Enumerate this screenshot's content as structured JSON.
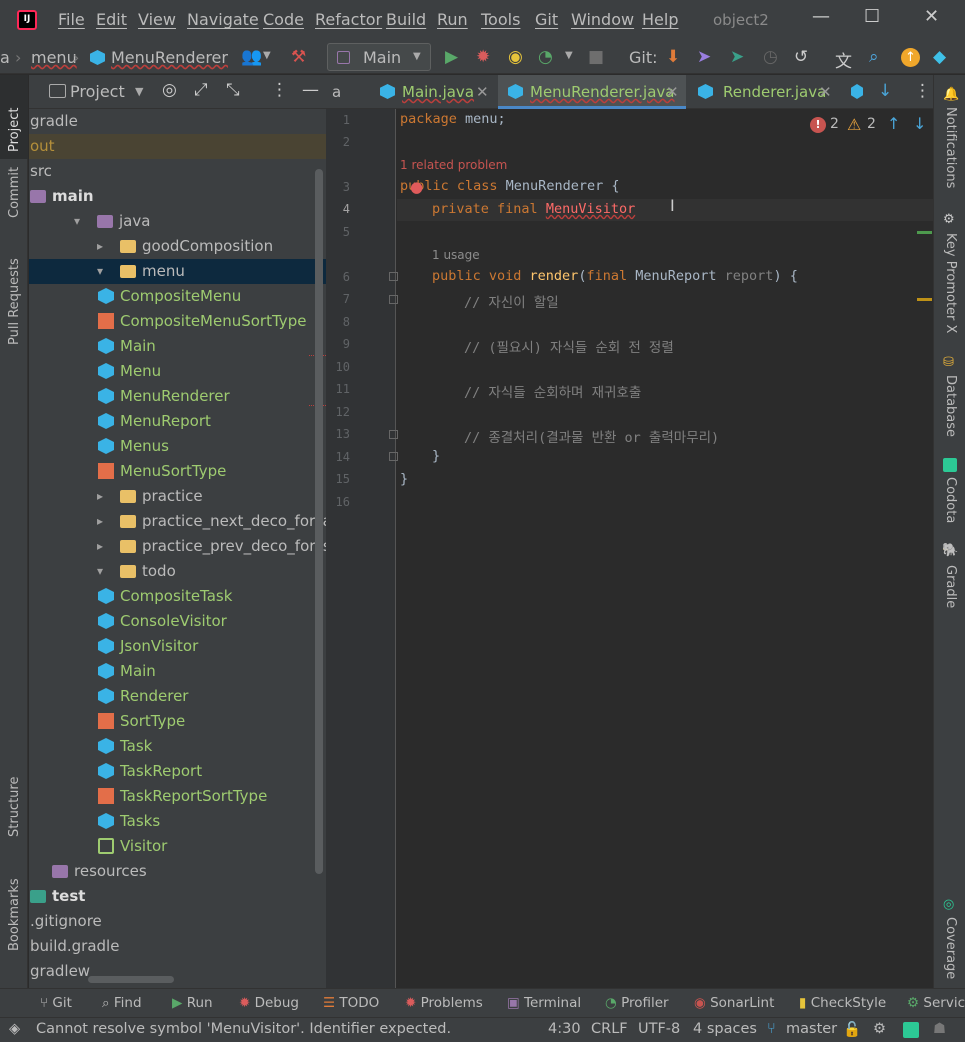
{
  "menubar": {
    "items": [
      "File",
      "Edit",
      "View",
      "Navigate",
      "Code",
      "Refactor",
      "Build",
      "Run",
      "Tools",
      "Git",
      "Window",
      "Help"
    ],
    "project_name": "object2",
    "min_glyph": "—",
    "max_glyph": "☐",
    "close_glyph": "✕"
  },
  "navbar": {
    "crumb_prev": "a",
    "crumb_menu": "menu",
    "crumb_file": "MenuRenderer",
    "run_config": "Main",
    "git_label": "Git:"
  },
  "sidebar_left": {
    "project": "Project",
    "commit": "Commit",
    "pull_requests": "Pull Requests",
    "structure": "Structure",
    "bookmarks": "Bookmarks"
  },
  "sidebar_right": {
    "notifications": "Notifications",
    "key_promoter": "Key Promoter X",
    "database": "Database",
    "codota": "Codota",
    "gradle": "Gradle",
    "coverage": "Coverage"
  },
  "project_panel": {
    "title": "Project"
  },
  "tree": [
    {
      "label": "gradle",
      "indent": 0,
      "arrow": "",
      "icon": "none",
      "style": "plain"
    },
    {
      "label": "out",
      "indent": 0,
      "arrow": "",
      "icon": "none",
      "style": "out"
    },
    {
      "label": "src",
      "indent": 0,
      "arrow": "",
      "icon": "none",
      "style": "plain"
    },
    {
      "label": "main",
      "indent": 0,
      "arrow": "",
      "icon": "folder-purple",
      "style": "bold"
    },
    {
      "label": "java",
      "indent": 1,
      "arrow": "▾",
      "icon": "folder-source",
      "style": "plain"
    },
    {
      "label": "goodComposition",
      "indent": 2,
      "arrow": "▸",
      "icon": "folder",
      "style": "plain"
    },
    {
      "label": "menu",
      "indent": 2,
      "arrow": "▾",
      "icon": "folder",
      "style": "plain",
      "selected": true
    },
    {
      "label": "CompositeMenu",
      "indent": 3,
      "arrow": "",
      "icon": "class",
      "style": "green"
    },
    {
      "label": "CompositeMenuSortType",
      "indent": 3,
      "arrow": "",
      "icon": "enum",
      "style": "green"
    },
    {
      "label": "Main",
      "indent": 3,
      "arrow": "",
      "icon": "class-main",
      "style": "green",
      "wavy": true
    },
    {
      "label": "Menu",
      "indent": 3,
      "arrow": "",
      "icon": "class",
      "style": "green"
    },
    {
      "label": "MenuRenderer",
      "indent": 3,
      "arrow": "",
      "icon": "class",
      "style": "green",
      "wavy": true
    },
    {
      "label": "MenuReport",
      "indent": 3,
      "arrow": "",
      "icon": "class",
      "style": "green"
    },
    {
      "label": "Menus",
      "indent": 3,
      "arrow": "",
      "icon": "class",
      "style": "green"
    },
    {
      "label": "MenuSortType",
      "indent": 3,
      "arrow": "",
      "icon": "enum",
      "style": "green"
    },
    {
      "label": "practice",
      "indent": 2,
      "arrow": "▸",
      "icon": "folder",
      "style": "plain"
    },
    {
      "label": "practice_next_deco_for_adding_cu",
      "indent": 2,
      "arrow": "▸",
      "icon": "folder",
      "style": "plain"
    },
    {
      "label": "practice_prev_deco_for_section",
      "indent": 2,
      "arrow": "▸",
      "icon": "folder",
      "style": "plain"
    },
    {
      "label": "todo",
      "indent": 2,
      "arrow": "▾",
      "icon": "folder",
      "style": "plain"
    },
    {
      "label": "CompositeTask",
      "indent": 3,
      "arrow": "",
      "icon": "class",
      "style": "green"
    },
    {
      "label": "ConsoleVisitor",
      "indent": 3,
      "arrow": "",
      "icon": "class",
      "style": "green"
    },
    {
      "label": "JsonVisitor",
      "indent": 3,
      "arrow": "",
      "icon": "class",
      "style": "green"
    },
    {
      "label": "Main",
      "indent": 3,
      "arrow": "",
      "icon": "class-main",
      "style": "green"
    },
    {
      "label": "Renderer",
      "indent": 3,
      "arrow": "",
      "icon": "class",
      "style": "green"
    },
    {
      "label": "SortType",
      "indent": 3,
      "arrow": "",
      "icon": "enum",
      "style": "green"
    },
    {
      "label": "Task",
      "indent": 3,
      "arrow": "",
      "icon": "class",
      "style": "green"
    },
    {
      "label": "TaskReport",
      "indent": 3,
      "arrow": "",
      "icon": "class",
      "style": "green"
    },
    {
      "label": "TaskReportSortType",
      "indent": 3,
      "arrow": "",
      "icon": "enum",
      "style": "green"
    },
    {
      "label": "Tasks",
      "indent": 3,
      "arrow": "",
      "icon": "class",
      "style": "green"
    },
    {
      "label": "Visitor",
      "indent": 3,
      "arrow": "",
      "icon": "interface",
      "style": "green"
    },
    {
      "label": "resources",
      "indent": 1,
      "arrow": "",
      "icon": "folder-res",
      "style": "plain"
    },
    {
      "label": "test",
      "indent": 0,
      "arrow": "",
      "icon": "folder-test",
      "style": "bold"
    },
    {
      "label": ".gitignore",
      "indent": 0,
      "arrow": "",
      "icon": "none",
      "style": "plain"
    },
    {
      "label": "build.gradle",
      "indent": 0,
      "arrow": "",
      "icon": "none",
      "style": "plain"
    },
    {
      "label": "gradlew",
      "indent": 0,
      "arrow": "",
      "icon": "none",
      "style": "plain"
    }
  ],
  "tabs": [
    {
      "label": "a",
      "active": false,
      "close": false
    },
    {
      "label": "Main.java",
      "active": false,
      "close": true
    },
    {
      "label": "MenuRenderer.java",
      "active": true,
      "close": true
    },
    {
      "label": "Renderer.java",
      "active": false,
      "close": true
    }
  ],
  "inspections": {
    "errors": "2",
    "warnings": "2"
  },
  "editor": {
    "line_numbers": [
      "1",
      "2",
      "3",
      "4",
      "5",
      "6",
      "7",
      "8",
      "9",
      "10",
      "11",
      "12",
      "13",
      "14",
      "15",
      "16"
    ],
    "hint_problem": "1 related problem",
    "hint_usage": "1 usage",
    "l1_kw": "package",
    "l1_rest": " menu;",
    "l3_kw": "public class",
    "l3_rest": " MenuRenderer {",
    "l4_kw": "private final",
    "l4_err": "MenuVisitor",
    "l6_kw1": "public void",
    "l6_fn": "render",
    "l6_p1": "(",
    "l6_kw2": "final",
    "l6_type": " MenuReport ",
    "l6_param": "report",
    "l6_end": ") {",
    "l7": "// 자신이 할일",
    "l9": "// (필요시) 자식들 순회 전 정렬",
    "l11": "// 자식들 순회하며 재귀호출",
    "l13": "// 종결처리(결과물 반환 or 출력마무리)",
    "l14": "}",
    "l15": "}"
  },
  "bottom_tools": [
    "Git",
    "Find",
    "Run",
    "Debug",
    "TODO",
    "Problems",
    "Terminal",
    "Profiler",
    "SonarLint",
    "CheckStyle",
    "Servic"
  ],
  "status": {
    "message": "Cannot resolve symbol 'MenuVisitor'. Identifier expected.",
    "position": "4:30",
    "line_sep": "CRLF",
    "encoding": "UTF-8",
    "indent": "4 spaces",
    "branch": "master"
  },
  "colors": {
    "accent": "#4a88c7",
    "error": "#ff6b68",
    "warning": "#e8a33e",
    "run_green": "#59a869"
  }
}
